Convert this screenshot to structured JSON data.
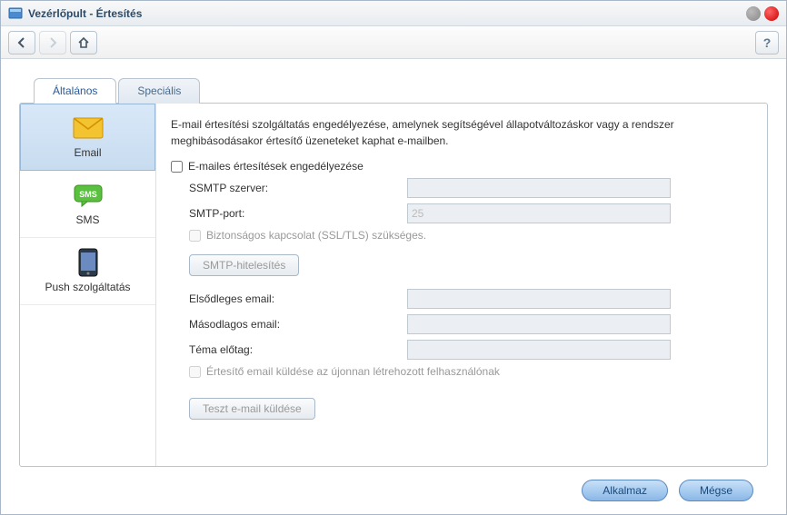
{
  "window": {
    "title": "Vezérlőpult - Értesítés"
  },
  "tabs": [
    {
      "label": "Általános"
    },
    {
      "label": "Speciális"
    }
  ],
  "sidebar": [
    {
      "label": "Email",
      "icon": "email"
    },
    {
      "label": "SMS",
      "icon": "sms"
    },
    {
      "label": "Push szolgáltatás",
      "icon": "push"
    }
  ],
  "main": {
    "description": "E-mail értesítési szolgáltatás engedélyezése, amelynek segítségével állapotváltozáskor vagy a rendszer meghibásodásakor értesítő üzeneteket kaphat e-mailben.",
    "enable_label": "E-mailes értesítések engedélyezése",
    "fields": {
      "ssmtp_server": {
        "label": "SSMTP szerver:",
        "value": ""
      },
      "smtp_port": {
        "label": "SMTP-port:",
        "value": "",
        "placeholder": "25"
      },
      "ssl_label": "Biztonságos kapcsolat (SSL/TLS) szükséges.",
      "smtp_auth_btn": "SMTP-hitelesítés",
      "primary_email": {
        "label": "Elsődleges email:",
        "value": ""
      },
      "secondary_email": {
        "label": "Másodlagos email:",
        "value": ""
      },
      "subject_prefix": {
        "label": "Téma előtag:",
        "value": ""
      },
      "notify_new_user": "Értesítő email küldése az újonnan létrehozott felhasználónak",
      "test_btn": "Teszt e-mail küldése"
    }
  },
  "footer": {
    "apply": "Alkalmaz",
    "cancel": "Mégse"
  }
}
